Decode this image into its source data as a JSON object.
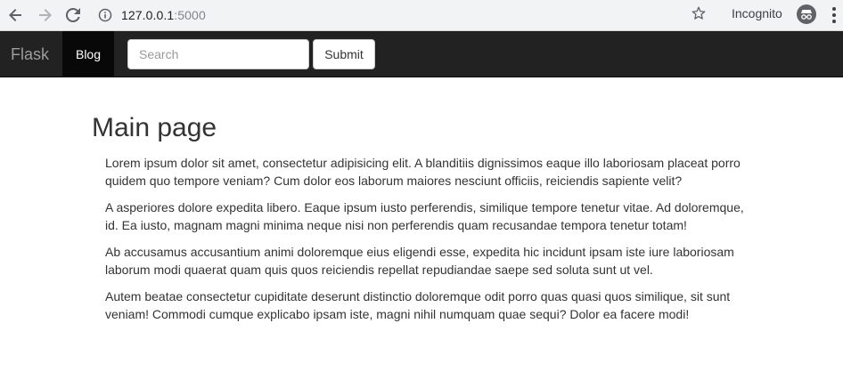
{
  "browser": {
    "url_host": "127.0.0.1",
    "url_port": ":5000",
    "incognito_label": "Incognito",
    "icons": [
      "back-arrow-icon",
      "forward-arrow-icon",
      "reload-icon",
      "info-icon",
      "star-icon",
      "incognito-icon",
      "menu-dots-icon"
    ]
  },
  "navbar": {
    "brand": "Flask",
    "blog_label": "Blog",
    "search_placeholder": "Search",
    "submit_label": "Submit"
  },
  "main": {
    "title": "Main page",
    "paragraphs": [
      "Lorem ipsum dolor sit amet, consectetur adipisicing elit. A blanditiis dignissimos eaque illo laboriosam placeat porro quidem quo tempore veniam? Cum dolor eos laborum maiores nesciunt officiis, reiciendis sapiente velit?",
      "A asperiores dolore expedita libero. Eaque ipsum iusto perferendis, similique tempore tenetur vitae. Ad doloremque, id. Ea iusto, magnam magni minima neque nisi non perferendis quam recusandae tempora tenetur totam!",
      "Ab accusamus accusantium animi doloremque eius eligendi esse, expedita hic incidunt ipsam iste iure laboriosam laborum modi quaerat quam quis quos reiciendis repellat repudiandae saepe sed soluta sunt ut vel.",
      "Autem beatae consectetur cupiditate deserunt distinctio doloremque odit porro quas quasi quos similique, sit sunt veniam! Commodi cumque explicabo ipsam iste, magni nihil numquam quae sequi? Dolor ea facere modi!"
    ]
  }
}
